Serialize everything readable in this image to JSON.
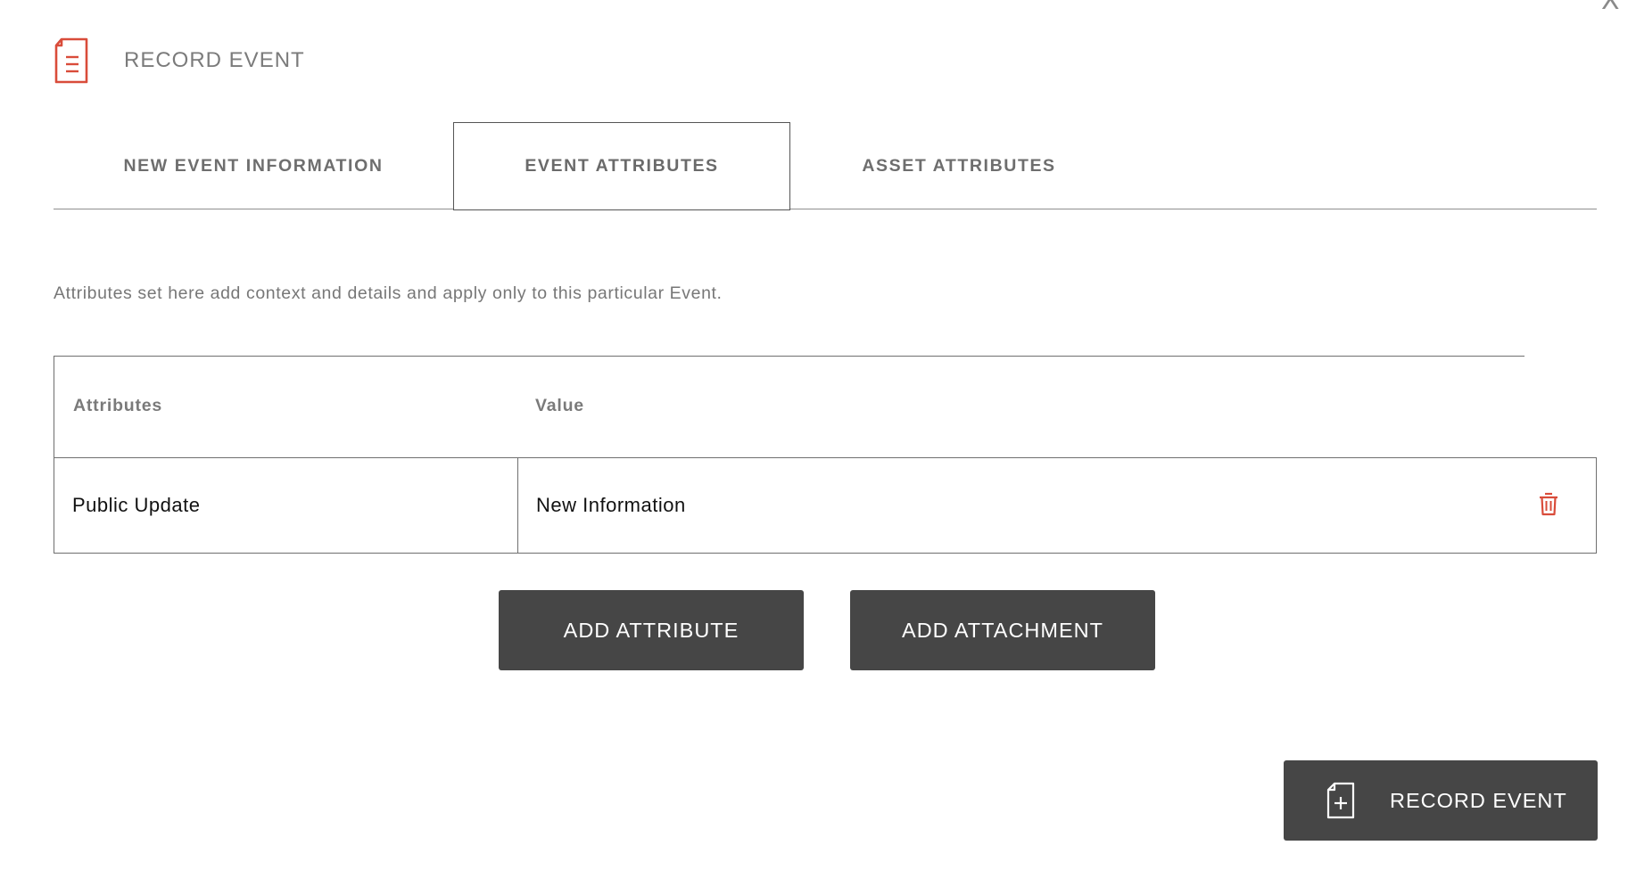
{
  "dialog": {
    "close_label": "X",
    "title": "RECORD EVENT",
    "header_icon": "document-list-icon",
    "accent_color": "#d94c3a"
  },
  "tabs": [
    {
      "label": "NEW EVENT INFORMATION",
      "active": false
    },
    {
      "label": "EVENT ATTRIBUTES",
      "active": true
    },
    {
      "label": "ASSET ATTRIBUTES",
      "active": false
    }
  ],
  "description": "Attributes set here add context and details and apply only to this particular Event.",
  "table": {
    "columns": [
      "Attributes",
      "Value"
    ],
    "rows": [
      {
        "attribute": "Public Update",
        "value": "New Information",
        "action_icon": "trash-icon"
      }
    ]
  },
  "buttons": {
    "add_attribute": "ADD ATTRIBUTE",
    "add_attachment": "ADD ATTACHMENT",
    "record_event": "RECORD EVENT",
    "record_event_icon": "file-plus-icon",
    "button_color": "#464646"
  }
}
